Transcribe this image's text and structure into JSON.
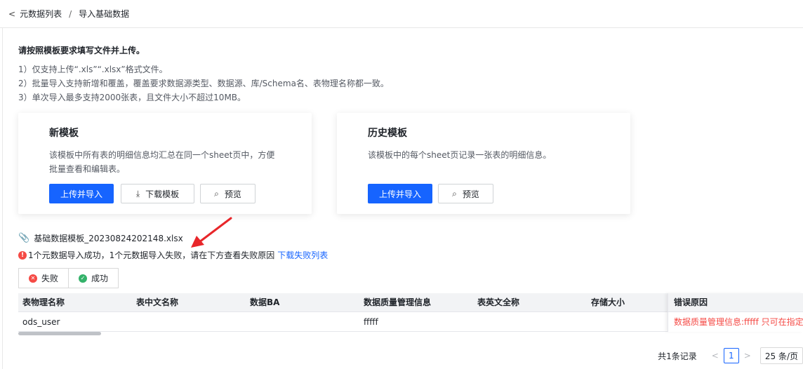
{
  "breadcrumb": {
    "parent": "元数据列表",
    "separator": "/",
    "current": "导入基础数据"
  },
  "intro": {
    "title": "请按照模板要求填写文件并上传。",
    "tips": [
      "1）仅支持上传“.xls”“.xlsx”格式文件。",
      "2）批量导入支持新增和覆盖，覆盖要求数据源类型、数据源、库/Schema名、表物理名称都一致。",
      "3）单次导入最多支持2000张表，且文件大小不超过10MB。"
    ]
  },
  "cards": {
    "new": {
      "title": "新模板",
      "desc_line1": "该模板中所有表的明细信息均汇总在同一个sheet页中，方便",
      "desc_line2": "批量查看和编辑表。",
      "upload_label": "上传并导入",
      "download_label": "下载模板",
      "preview_label": "预览"
    },
    "history": {
      "title": "历史模板",
      "desc_line1": "该模板中的每个sheet页记录一张表的明细信息。",
      "upload_label": "上传并导入",
      "preview_label": "预览"
    }
  },
  "result": {
    "file_name": "基础数据模板_20230824202148.xlsx",
    "message": "1个元数据导入成功，1个元数据导入失败，请在下方查看失败原因",
    "download_fail_link": "下载失败列表"
  },
  "tabs": [
    {
      "label": "失败"
    },
    {
      "label": "成功"
    }
  ],
  "table": {
    "columns": [
      "表物理名称",
      "表中文名称",
      "数据BA",
      "数据质量管理信息",
      "表英文全称",
      "存储大小"
    ],
    "fixed_column": "错误原因",
    "rows": [
      {
        "cells": [
          "ods_user",
          "",
          "",
          "fffff",
          "",
          ""
        ],
        "error": "数据质量管理信息:fffff 只可在指定"
      }
    ]
  },
  "pagination": {
    "total": "共1条记录",
    "current_page": "1",
    "page_size": "25 条/页"
  },
  "colors": {
    "primary": "#1664ff",
    "error": "#f54a45",
    "success": "#34b26a",
    "annotation_arrow": "#e8262a"
  }
}
